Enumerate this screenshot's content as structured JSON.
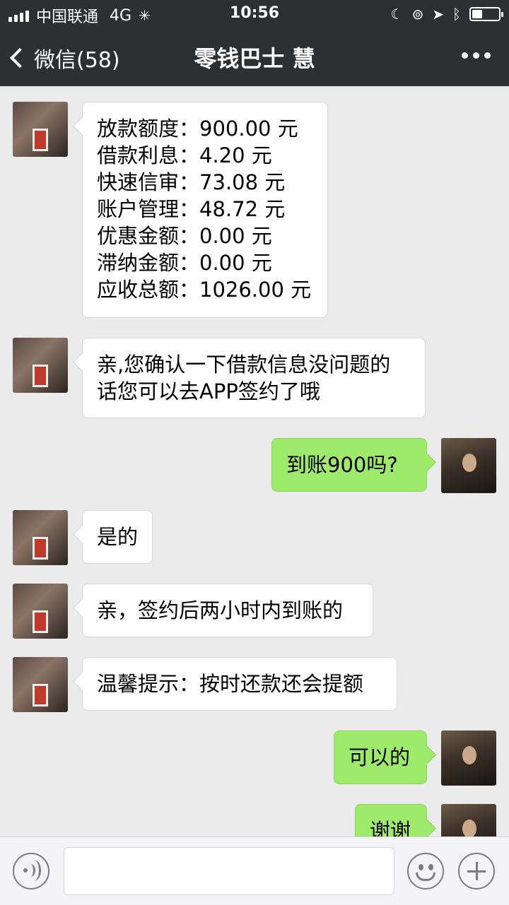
{
  "status_bar": {
    "carrier": "中国联通",
    "network": "4G",
    "time": "10:56"
  },
  "nav": {
    "back_label": "微信(58)",
    "title": "零钱巴士 慧"
  },
  "messages": [
    {
      "side": "left",
      "lines": [
        "放款额度：900.00 元",
        "借款利息：4.20 元",
        "快速信审：73.08 元",
        "账户管理：48.72 元",
        "优惠金额：0.00 元",
        "滞纳金额：0.00 元",
        "应收总额：1026.00 元"
      ]
    },
    {
      "side": "left",
      "lines": [
        "亲,您确认一下借款信息没问题的",
        "话您可以去APP签约了哦"
      ]
    },
    {
      "side": "right",
      "lines": [
        "到账900吗?"
      ]
    },
    {
      "side": "left",
      "lines": [
        "是的"
      ]
    },
    {
      "side": "left",
      "lines": [
        "亲，签约后两小时内到账的"
      ]
    },
    {
      "side": "left",
      "lines": [
        "温馨提示：按时还款还会提额"
      ]
    },
    {
      "side": "right",
      "lines": [
        "可以的"
      ]
    },
    {
      "side": "right",
      "lines": [
        "谢谢"
      ]
    }
  ],
  "colors": {
    "header_bg": "#2e2f33",
    "chat_bg": "#ebebeb",
    "own_bubble": "#9eea6a",
    "other_bubble": "#ffffff"
  },
  "icons": [
    "signal-icon",
    "loading-icon",
    "moon-icon",
    "lock-rotation-icon",
    "location-icon",
    "bluetooth-icon",
    "battery-icon",
    "back-chevron-icon",
    "more-icon",
    "voice-icon",
    "emoji-icon",
    "plus-icon"
  ]
}
